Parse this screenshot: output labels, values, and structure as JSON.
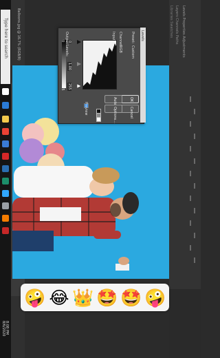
{
  "taskbar": {
    "search_placeholder": "Type here to search",
    "tray_time": "8:08 PM",
    "tray_date": "8/6/2020",
    "icons": [
      {
        "name": "task-view-icon",
        "color": "#ffffff"
      },
      {
        "name": "edge-icon",
        "color": "#2b7bd6"
      },
      {
        "name": "explorer-icon",
        "color": "#f2c94c"
      },
      {
        "name": "chrome-icon",
        "color": "#e94235"
      },
      {
        "name": "store-icon",
        "color": "#3a7bd5"
      },
      {
        "name": "opera-icon",
        "color": "#d62828"
      },
      {
        "name": "mail-icon",
        "color": "#2a6db0"
      },
      {
        "name": "photos-icon",
        "color": "#1c8e6a"
      },
      {
        "name": "photoshop-icon",
        "color": "#31a8ff"
      },
      {
        "name": "settings-icon",
        "color": "#9aa0a6"
      },
      {
        "name": "media-icon",
        "color": "#f57c00"
      },
      {
        "name": "app-icon",
        "color": "#c62828"
      }
    ]
  },
  "photoshop": {
    "doc_tab": "Balloons.jpg @ 16.7% (RGB/8)",
    "panel_line_1": "Levels  Properties  Adjustments",
    "panel_line_2": "Layers  Channels  Paths",
    "panel_line_3": "Libraries  Swatches"
  },
  "levels_dialog": {
    "title": "Levels",
    "preset_label": "Preset:",
    "preset_value": "Custom",
    "channel_label": "Channel:",
    "channel_value": "RGB",
    "input_levels_label": "Input Levels:",
    "input_values": [
      "0",
      "1.00",
      "255"
    ],
    "output_levels_label": "Output Levels:",
    "output_values": [
      "0",
      "255"
    ],
    "ok_label": "OK",
    "cancel_label": "Cancel",
    "auto_label": "Auto",
    "options_label": "Options...",
    "preview_label": "Preview",
    "preview_checked": true
  },
  "reactions": {
    "emojis": [
      "🤪",
      "😂",
      "👑",
      "🤩",
      "🤩",
      "🤪"
    ]
  },
  "colors": {
    "canvas_bg": "#2ba9e0",
    "shirt": "#b23a35",
    "reaction_bar": "#f5f5f5"
  }
}
